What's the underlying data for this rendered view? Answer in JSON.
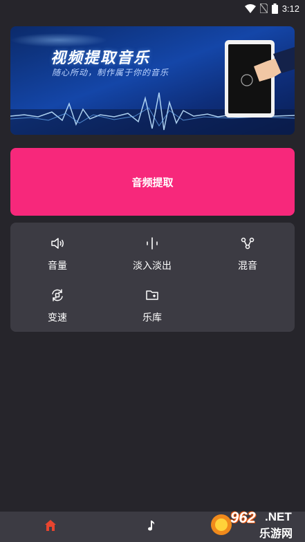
{
  "status_bar": {
    "time": "3:12",
    "icons": [
      "wifi-icon",
      "no-sim-icon",
      "battery-icon"
    ]
  },
  "banner": {
    "title": "视频提取音乐",
    "subtitle": "随心所动，制作属于你的音乐"
  },
  "primary_action": {
    "label": "音频提取",
    "color": "#f7287b"
  },
  "tools": [
    {
      "label": "音量",
      "icon": "volume-icon"
    },
    {
      "label": "淡入淡出",
      "icon": "fade-icon"
    },
    {
      "label": "混音",
      "icon": "mix-icon"
    },
    {
      "label": "变速",
      "icon": "speed-icon"
    },
    {
      "label": "乐库",
      "icon": "library-folder-icon"
    }
  ],
  "bottom_nav": {
    "items": [
      {
        "icon": "home-icon",
        "active": true
      },
      {
        "icon": "music-note-icon",
        "active": false
      }
    ],
    "active_color": "#e8452f"
  },
  "watermark": {
    "number": "962",
    "domain": ".NET",
    "name": "乐游网"
  }
}
